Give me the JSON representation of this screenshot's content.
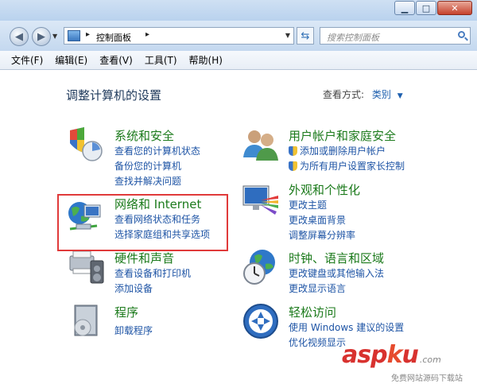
{
  "window": {
    "address": {
      "text": "控制面板"
    },
    "search": {
      "placeholder": "搜索控制面板"
    }
  },
  "menubar": [
    "文件(F)",
    "编辑(E)",
    "查看(V)",
    "工具(T)",
    "帮助(H)"
  ],
  "page": {
    "title": "调整计算机的设置",
    "view_by_label": "查看方式:",
    "view_by_value": "类别"
  },
  "categories": [
    {
      "title": "系统和安全",
      "icon": "system-security-icon",
      "links": [
        "查看您的计算机状态",
        "备份您的计算机",
        "查找并解决问题"
      ]
    },
    {
      "title": "网络和 Internet",
      "icon": "network-internet-icon",
      "links": [
        "查看网络状态和任务",
        "选择家庭组和共享选项"
      ]
    },
    {
      "title": "硬件和声音",
      "icon": "hardware-sound-icon",
      "links": [
        "查看设备和打印机",
        "添加设备"
      ]
    },
    {
      "title": "程序",
      "icon": "programs-icon",
      "links": [
        "卸载程序"
      ]
    },
    {
      "title": "用户帐户和家庭安全",
      "icon": "user-accounts-icon",
      "links": [
        "添加或删除用户帐户",
        "为所有用户设置家长控制"
      ]
    },
    {
      "title": "外观和个性化",
      "icon": "appearance-icon",
      "links": [
        "更改主题",
        "更改桌面背景",
        "调整屏幕分辨率"
      ]
    },
    {
      "title": "时钟、语言和区域",
      "icon": "clock-language-region-icon",
      "links": [
        "更改键盘或其他输入法",
        "更改显示语言"
      ]
    },
    {
      "title": "轻松访问",
      "icon": "ease-of-access-icon",
      "links": [
        "使用 Windows 建议的设置",
        "优化视频显示"
      ]
    }
  ],
  "watermark": {
    "brand": "asp",
    "brand_k": "k",
    "brand_u": "u",
    "suffix": ".com",
    "tagline": "免费网站源码下载站"
  },
  "colors": {
    "category_title": "#1b7a1b",
    "link": "#1e54a5",
    "highlight_box": "#e03a3a"
  }
}
